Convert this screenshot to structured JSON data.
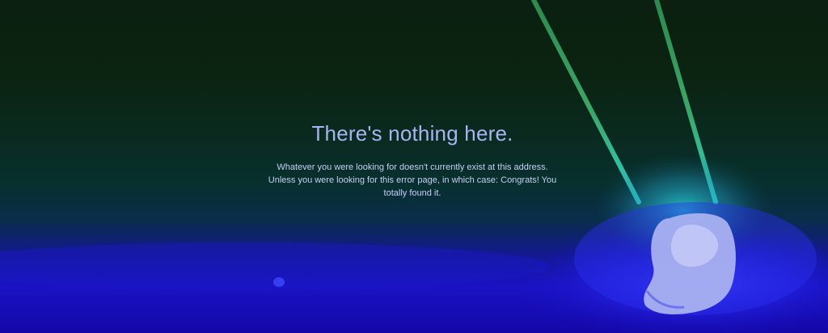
{
  "page": {
    "title": "There's nothing here.",
    "message": "Whatever you were looking for doesn't currently exist at this address. Unless you were looking for this error page, in which case: Congrats! You totally found it."
  },
  "background": {
    "subject": "swing ropes and seat",
    "colors": {
      "top": "#0b2110",
      "bottom": "#1408a8",
      "rope": "#2f9a5e",
      "glow": "#20c8d0",
      "seat": "#a9b1f0"
    }
  }
}
